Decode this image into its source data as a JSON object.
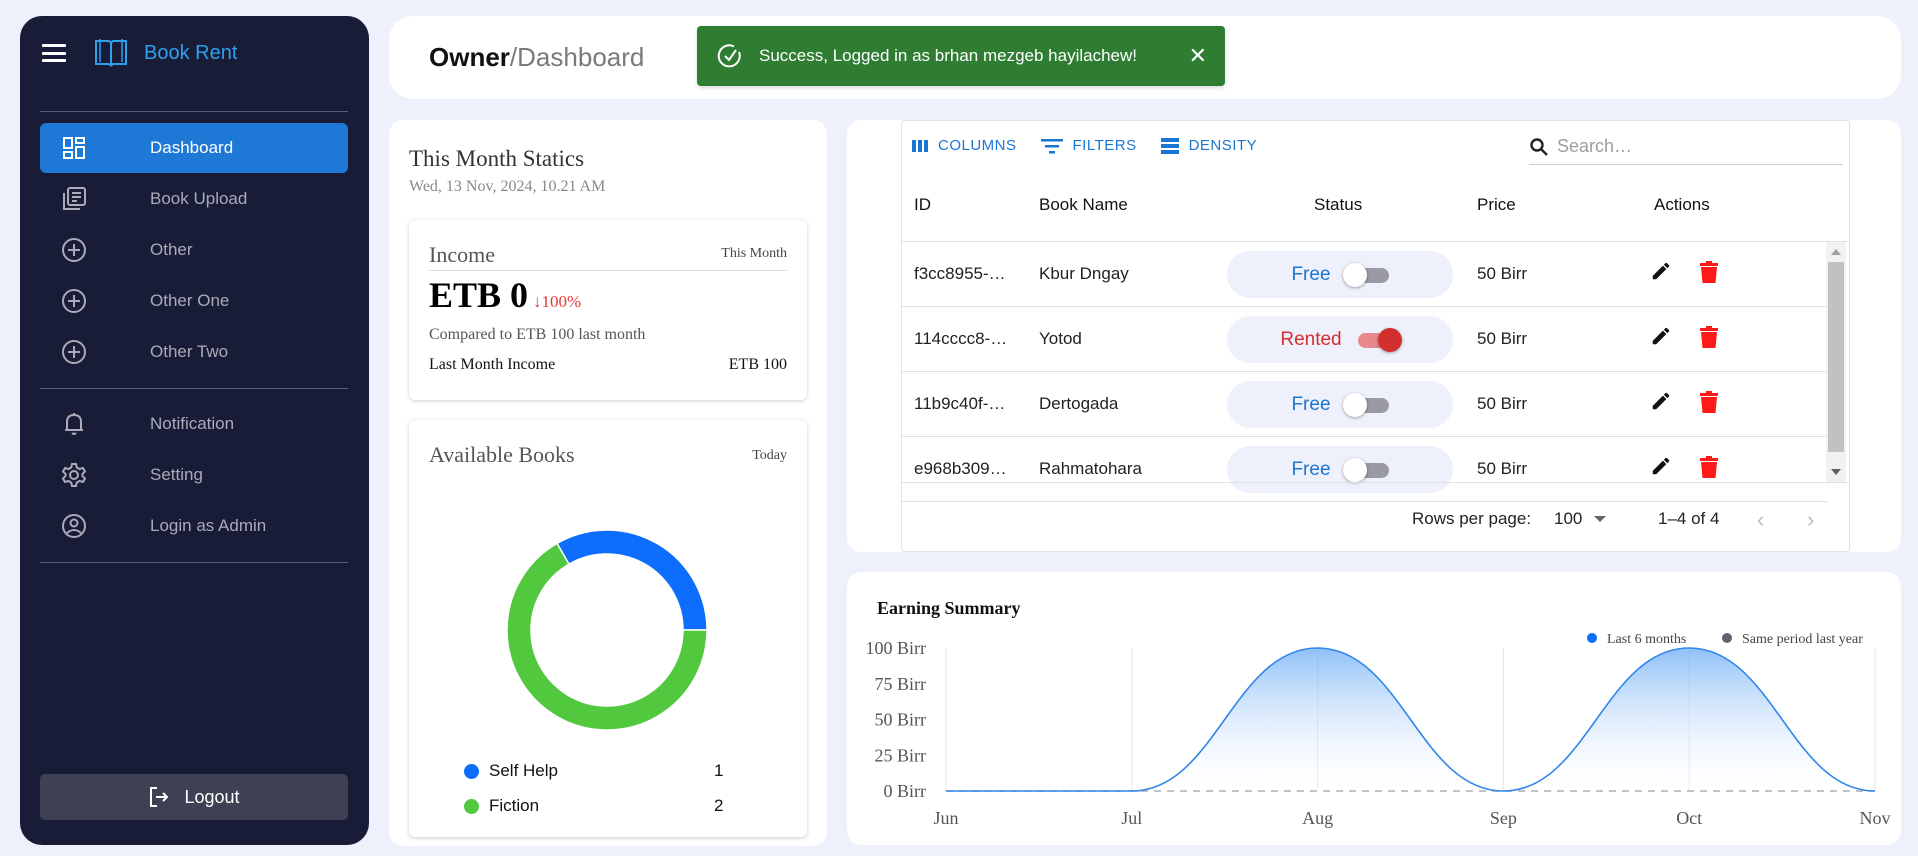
{
  "sidebar": {
    "brand": "Book Rent",
    "items": [
      {
        "label": "Dashboard",
        "icon": "dashboard-icon",
        "active": true
      },
      {
        "label": "Book Upload",
        "icon": "library-books-icon"
      },
      {
        "label": "Other",
        "icon": "add-circle-icon"
      },
      {
        "label": "Other One",
        "icon": "add-circle-icon"
      },
      {
        "label": "Other Two",
        "icon": "add-circle-icon"
      },
      {
        "label": "Notification",
        "icon": "bell-icon"
      },
      {
        "label": "Setting",
        "icon": "gear-icon"
      },
      {
        "label": "Login as Admin",
        "icon": "account-circle-icon"
      }
    ],
    "logout_label": "Logout"
  },
  "header": {
    "crumb_owner": "Owner",
    "crumb_sep": "/",
    "crumb_page": "Dashboard",
    "toast": {
      "message": "Success, Logged in as brhan mezgeb hayilachew!",
      "close": "✕",
      "color": "#2e7d32"
    }
  },
  "stats": {
    "title": "This Month Statics",
    "date": "Wed, 13 Nov, 2024, 10.21 AM",
    "income": {
      "title": "Income",
      "period": "This Month",
      "value": "ETB 0",
      "change_arrow": "↓",
      "change": "100%",
      "compare": "Compared to ETB 100 last month",
      "last_label": "Last Month Income",
      "last_value": "ETB 100"
    },
    "books": {
      "title": "Available Books",
      "period": "Today",
      "legend": [
        {
          "label": "Self Help",
          "value": "1",
          "color": "#0d6efd"
        },
        {
          "label": "Fiction",
          "value": "2",
          "color": "#52c83f"
        }
      ]
    }
  },
  "table": {
    "toolbar": {
      "columns": "COLUMNS",
      "filters": "FILTERS",
      "density": "DENSITY"
    },
    "search_placeholder": "Search…",
    "headers": {
      "id": "ID",
      "name": "Book Name",
      "status": "Status",
      "price": "Price",
      "actions": "Actions"
    },
    "rows": [
      {
        "id": "f3cc8955-…",
        "name": "Kbur Dngay",
        "status": "Free",
        "rented": false,
        "price": "50 Birr"
      },
      {
        "id": "114cccc8-…",
        "name": "Yotod",
        "status": "Rented",
        "rented": true,
        "price": "50 Birr"
      },
      {
        "id": "11b9c40f-…",
        "name": "Dertogada",
        "status": "Free",
        "rented": false,
        "price": "50 Birr"
      },
      {
        "id": "e968b309…",
        "name": "Rahmatohara",
        "status": "Free",
        "rented": false,
        "price": "50 Birr"
      }
    ],
    "footer": {
      "rows_per_page_label": "Rows per page:",
      "rows_per_page": "100",
      "range": "1–4 of 4",
      "prev": "‹",
      "next": "›"
    }
  },
  "chart_data": [
    {
      "type": "pie",
      "title": "Available Books",
      "donut": true,
      "categories": [
        "Self Help",
        "Fiction"
      ],
      "values": [
        1,
        2
      ],
      "colors": [
        "#0d6efd",
        "#52c83f"
      ]
    },
    {
      "type": "area",
      "title": "Earning Summary",
      "categories": [
        "Jun",
        "Jul",
        "Aug",
        "Sep",
        "Oct",
        "Nov"
      ],
      "series": [
        {
          "name": "Last 6 months",
          "values": [
            0,
            0,
            100,
            0,
            100,
            0
          ],
          "color": "#0d6efd"
        },
        {
          "name": "Same period last year",
          "values": [
            0,
            0,
            0,
            0,
            0,
            0
          ],
          "color": "#636370"
        }
      ],
      "yticks": [
        "0 Birr",
        "25 Birr",
        "50 Birr",
        "75 Birr",
        "100 Birr"
      ],
      "ylim": [
        0,
        100
      ],
      "legend": "top-right",
      "grid": "vertical"
    }
  ]
}
